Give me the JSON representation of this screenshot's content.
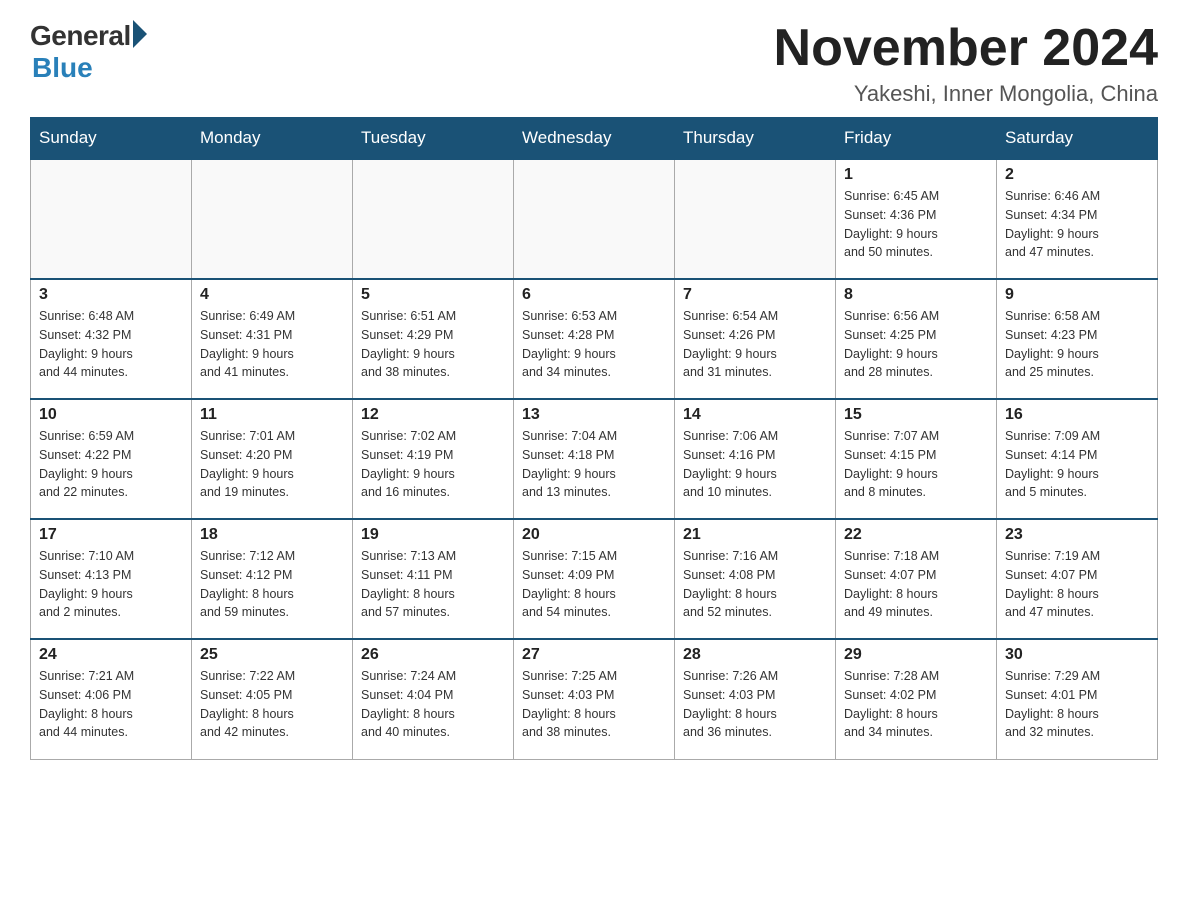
{
  "header": {
    "logo_general": "General",
    "logo_blue": "Blue",
    "month_title": "November 2024",
    "location": "Yakeshi, Inner Mongolia, China"
  },
  "days_of_week": [
    "Sunday",
    "Monday",
    "Tuesday",
    "Wednesday",
    "Thursday",
    "Friday",
    "Saturday"
  ],
  "weeks": [
    [
      {
        "day": "",
        "info": ""
      },
      {
        "day": "",
        "info": ""
      },
      {
        "day": "",
        "info": ""
      },
      {
        "day": "",
        "info": ""
      },
      {
        "day": "",
        "info": ""
      },
      {
        "day": "1",
        "info": "Sunrise: 6:45 AM\nSunset: 4:36 PM\nDaylight: 9 hours\nand 50 minutes."
      },
      {
        "day": "2",
        "info": "Sunrise: 6:46 AM\nSunset: 4:34 PM\nDaylight: 9 hours\nand 47 minutes."
      }
    ],
    [
      {
        "day": "3",
        "info": "Sunrise: 6:48 AM\nSunset: 4:32 PM\nDaylight: 9 hours\nand 44 minutes."
      },
      {
        "day": "4",
        "info": "Sunrise: 6:49 AM\nSunset: 4:31 PM\nDaylight: 9 hours\nand 41 minutes."
      },
      {
        "day": "5",
        "info": "Sunrise: 6:51 AM\nSunset: 4:29 PM\nDaylight: 9 hours\nand 38 minutes."
      },
      {
        "day": "6",
        "info": "Sunrise: 6:53 AM\nSunset: 4:28 PM\nDaylight: 9 hours\nand 34 minutes."
      },
      {
        "day": "7",
        "info": "Sunrise: 6:54 AM\nSunset: 4:26 PM\nDaylight: 9 hours\nand 31 minutes."
      },
      {
        "day": "8",
        "info": "Sunrise: 6:56 AM\nSunset: 4:25 PM\nDaylight: 9 hours\nand 28 minutes."
      },
      {
        "day": "9",
        "info": "Sunrise: 6:58 AM\nSunset: 4:23 PM\nDaylight: 9 hours\nand 25 minutes."
      }
    ],
    [
      {
        "day": "10",
        "info": "Sunrise: 6:59 AM\nSunset: 4:22 PM\nDaylight: 9 hours\nand 22 minutes."
      },
      {
        "day": "11",
        "info": "Sunrise: 7:01 AM\nSunset: 4:20 PM\nDaylight: 9 hours\nand 19 minutes."
      },
      {
        "day": "12",
        "info": "Sunrise: 7:02 AM\nSunset: 4:19 PM\nDaylight: 9 hours\nand 16 minutes."
      },
      {
        "day": "13",
        "info": "Sunrise: 7:04 AM\nSunset: 4:18 PM\nDaylight: 9 hours\nand 13 minutes."
      },
      {
        "day": "14",
        "info": "Sunrise: 7:06 AM\nSunset: 4:16 PM\nDaylight: 9 hours\nand 10 minutes."
      },
      {
        "day": "15",
        "info": "Sunrise: 7:07 AM\nSunset: 4:15 PM\nDaylight: 9 hours\nand 8 minutes."
      },
      {
        "day": "16",
        "info": "Sunrise: 7:09 AM\nSunset: 4:14 PM\nDaylight: 9 hours\nand 5 minutes."
      }
    ],
    [
      {
        "day": "17",
        "info": "Sunrise: 7:10 AM\nSunset: 4:13 PM\nDaylight: 9 hours\nand 2 minutes."
      },
      {
        "day": "18",
        "info": "Sunrise: 7:12 AM\nSunset: 4:12 PM\nDaylight: 8 hours\nand 59 minutes."
      },
      {
        "day": "19",
        "info": "Sunrise: 7:13 AM\nSunset: 4:11 PM\nDaylight: 8 hours\nand 57 minutes."
      },
      {
        "day": "20",
        "info": "Sunrise: 7:15 AM\nSunset: 4:09 PM\nDaylight: 8 hours\nand 54 minutes."
      },
      {
        "day": "21",
        "info": "Sunrise: 7:16 AM\nSunset: 4:08 PM\nDaylight: 8 hours\nand 52 minutes."
      },
      {
        "day": "22",
        "info": "Sunrise: 7:18 AM\nSunset: 4:07 PM\nDaylight: 8 hours\nand 49 minutes."
      },
      {
        "day": "23",
        "info": "Sunrise: 7:19 AM\nSunset: 4:07 PM\nDaylight: 8 hours\nand 47 minutes."
      }
    ],
    [
      {
        "day": "24",
        "info": "Sunrise: 7:21 AM\nSunset: 4:06 PM\nDaylight: 8 hours\nand 44 minutes."
      },
      {
        "day": "25",
        "info": "Sunrise: 7:22 AM\nSunset: 4:05 PM\nDaylight: 8 hours\nand 42 minutes."
      },
      {
        "day": "26",
        "info": "Sunrise: 7:24 AM\nSunset: 4:04 PM\nDaylight: 8 hours\nand 40 minutes."
      },
      {
        "day": "27",
        "info": "Sunrise: 7:25 AM\nSunset: 4:03 PM\nDaylight: 8 hours\nand 38 minutes."
      },
      {
        "day": "28",
        "info": "Sunrise: 7:26 AM\nSunset: 4:03 PM\nDaylight: 8 hours\nand 36 minutes."
      },
      {
        "day": "29",
        "info": "Sunrise: 7:28 AM\nSunset: 4:02 PM\nDaylight: 8 hours\nand 34 minutes."
      },
      {
        "day": "30",
        "info": "Sunrise: 7:29 AM\nSunset: 4:01 PM\nDaylight: 8 hours\nand 32 minutes."
      }
    ]
  ]
}
